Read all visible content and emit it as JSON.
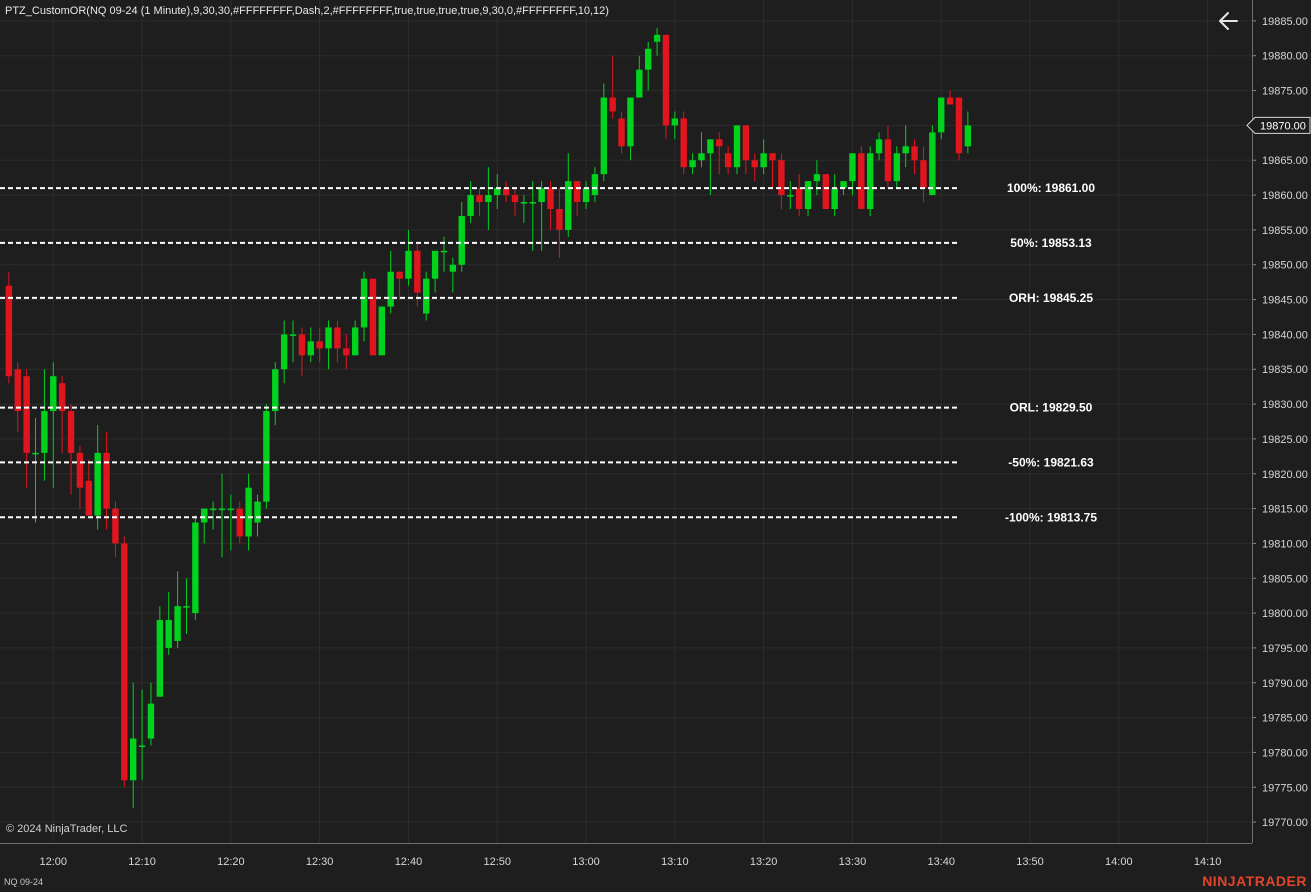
{
  "indicator_title": "PTZ_CustomOR(NQ 09-24 (1 Minute),9,30,30,#FFFFFFFF,Dash,2,#FFFFFFFF,true,true,true,true,9,30,0,#FFFFFFFF,10,12)",
  "copyright": "© 2024 NinjaTrader, LLC",
  "instrument": "NQ 09-24",
  "brand": "NINJATRADER",
  "back_icon": "arrow-left-icon",
  "colors": {
    "background": "#1e1e1e",
    "grid": "#2c2c2c",
    "up": "#00d21e",
    "down": "#e0151e",
    "level_line": "#ffffff",
    "brand": "#e0452b"
  },
  "chart_data": {
    "type": "candlestick",
    "instrument": "NQ 09-24 (1 Minute)",
    "ylim": [
      19767,
      19888
    ],
    "xlim": [
      "11:54",
      "14:15"
    ],
    "y_ticks": [
      "19885.00",
      "19880.00",
      "19875.00",
      "19870.00",
      "19865.00",
      "19860.00",
      "19855.00",
      "19850.00",
      "19845.00",
      "19840.00",
      "19835.00",
      "19830.00",
      "19825.00",
      "19820.00",
      "19815.00",
      "19810.00",
      "19805.00",
      "19800.00",
      "19795.00",
      "19790.00",
      "19785.00",
      "19780.00",
      "19775.00",
      "19770.00"
    ],
    "x_ticks": [
      "12:00",
      "12:10",
      "12:20",
      "12:30",
      "12:40",
      "12:50",
      "13:00",
      "13:10",
      "13:20",
      "13:30",
      "13:40",
      "13:50",
      "14:00",
      "14:10"
    ],
    "current_price": "19870.00",
    "levels": [
      {
        "label": "100%: 19861.00",
        "value": 19861.0
      },
      {
        "label": "50%: 19853.13",
        "value": 19853.13
      },
      {
        "label": "ORH: 19845.25",
        "value": 19845.25
      },
      {
        "label": "ORL: 19829.50",
        "value": 19829.5
      },
      {
        "label": "-50%: 19821.63",
        "value": 19821.63
      },
      {
        "label": "-100%: 19813.75",
        "value": 19813.75
      }
    ],
    "levels_end_time": "13:42",
    "candles": [
      {
        "t": "11:55",
        "o": 19847,
        "h": 19849,
        "l": 19833,
        "c": 19834
      },
      {
        "t": "11:56",
        "o": 19835,
        "h": 19836,
        "l": 19826,
        "c": 19829
      },
      {
        "t": "11:57",
        "o": 19834,
        "h": 19835,
        "l": 19818,
        "c": 19823
      },
      {
        "t": "11:58",
        "o": 19823,
        "h": 19828,
        "l": 19813,
        "c": 19823
      },
      {
        "t": "11:59",
        "o": 19823,
        "h": 19835,
        "l": 19819,
        "c": 19829
      },
      {
        "t": "12:00",
        "o": 19829,
        "h": 19836,
        "l": 19818,
        "c": 19834
      },
      {
        "t": "12:01",
        "o": 19833,
        "h": 19834,
        "l": 19823,
        "c": 19829
      },
      {
        "t": "12:02",
        "o": 19829,
        "h": 19830,
        "l": 19817,
        "c": 19823
      },
      {
        "t": "12:03",
        "o": 19823,
        "h": 19824,
        "l": 19815,
        "c": 19818
      },
      {
        "t": "12:04",
        "o": 19819,
        "h": 19822,
        "l": 19814,
        "c": 19814
      },
      {
        "t": "12:05",
        "o": 19814,
        "h": 19827,
        "l": 19812,
        "c": 19823
      },
      {
        "t": "12:06",
        "o": 19823,
        "h": 19826,
        "l": 19812,
        "c": 19815
      },
      {
        "t": "12:07",
        "o": 19815,
        "h": 19816,
        "l": 19808,
        "c": 19810
      },
      {
        "t": "12:08",
        "o": 19810,
        "h": 19811,
        "l": 19775,
        "c": 19776
      },
      {
        "t": "12:09",
        "o": 19776,
        "h": 19790,
        "l": 19772,
        "c": 19782
      },
      {
        "t": "12:10",
        "o": 19781,
        "h": 19789,
        "l": 19776,
        "c": 19781
      },
      {
        "t": "12:11",
        "o": 19782,
        "h": 19790,
        "l": 19781,
        "c": 19787
      },
      {
        "t": "12:12",
        "o": 19788,
        "h": 19801,
        "l": 19788,
        "c": 19799
      },
      {
        "t": "12:13",
        "o": 19795,
        "h": 19803,
        "l": 19794,
        "c": 19799
      },
      {
        "t": "12:14",
        "o": 19796,
        "h": 19806,
        "l": 19795,
        "c": 19801
      },
      {
        "t": "12:15",
        "o": 19801,
        "h": 19805,
        "l": 19797,
        "c": 19801
      },
      {
        "t": "12:16",
        "o": 19800,
        "h": 19814,
        "l": 19799,
        "c": 19813
      },
      {
        "t": "12:17",
        "o": 19813,
        "h": 19815,
        "l": 19810,
        "c": 19815
      },
      {
        "t": "12:18",
        "o": 19815,
        "h": 19816,
        "l": 19812,
        "c": 19815
      },
      {
        "t": "12:19",
        "o": 19815,
        "h": 19820,
        "l": 19808,
        "c": 19815
      },
      {
        "t": "12:20",
        "o": 19815,
        "h": 19817,
        "l": 19809,
        "c": 19815
      },
      {
        "t": "12:21",
        "o": 19815,
        "h": 19816,
        "l": 19810,
        "c": 19811
      },
      {
        "t": "12:22",
        "o": 19811,
        "h": 19820,
        "l": 19809,
        "c": 19818
      },
      {
        "t": "12:23",
        "o": 19813,
        "h": 19817,
        "l": 19811,
        "c": 19816
      },
      {
        "t": "12:24",
        "o": 19816,
        "h": 19830,
        "l": 19815,
        "c": 19829
      },
      {
        "t": "12:25",
        "o": 19829,
        "h": 19836,
        "l": 19827,
        "c": 19835
      },
      {
        "t": "12:26",
        "o": 19835,
        "h": 19842,
        "l": 19833,
        "c": 19840
      },
      {
        "t": "12:27",
        "o": 19840,
        "h": 19842,
        "l": 19836,
        "c": 19840
      },
      {
        "t": "12:28",
        "o": 19840,
        "h": 19841,
        "l": 19834,
        "c": 19837
      },
      {
        "t": "12:29",
        "o": 19837,
        "h": 19841,
        "l": 19836,
        "c": 19839
      },
      {
        "t": "12:30",
        "o": 19839,
        "h": 19841,
        "l": 19836,
        "c": 19838
      },
      {
        "t": "12:31",
        "o": 19838,
        "h": 19842,
        "l": 19835,
        "c": 19841
      },
      {
        "t": "12:32",
        "o": 19841,
        "h": 19842,
        "l": 19836,
        "c": 19838
      },
      {
        "t": "12:33",
        "o": 19838,
        "h": 19840,
        "l": 19835,
        "c": 19837
      },
      {
        "t": "12:34",
        "o": 19837,
        "h": 19842,
        "l": 19837,
        "c": 19841
      },
      {
        "t": "12:35",
        "o": 19841,
        "h": 19849,
        "l": 19839,
        "c": 19848
      },
      {
        "t": "12:36",
        "o": 19848,
        "h": 19848,
        "l": 19837,
        "c": 19837
      },
      {
        "t": "12:37",
        "o": 19837,
        "h": 19844,
        "l": 19837,
        "c": 19844
      },
      {
        "t": "12:38",
        "o": 19844,
        "h": 19852,
        "l": 19843,
        "c": 19849
      },
      {
        "t": "12:39",
        "o": 19849,
        "h": 19849,
        "l": 19845,
        "c": 19848
      },
      {
        "t": "12:40",
        "o": 19848,
        "h": 19855,
        "l": 19847,
        "c": 19852
      },
      {
        "t": "12:41",
        "o": 19852,
        "h": 19853,
        "l": 19844,
        "c": 19846
      },
      {
        "t": "12:42",
        "o": 19843,
        "h": 19849,
        "l": 19842,
        "c": 19848
      },
      {
        "t": "12:43",
        "o": 19848,
        "h": 19852,
        "l": 19846,
        "c": 19852
      },
      {
        "t": "12:44",
        "o": 19852,
        "h": 19854,
        "l": 19849,
        "c": 19852
      },
      {
        "t": "12:45",
        "o": 19849,
        "h": 19851,
        "l": 19846,
        "c": 19850
      },
      {
        "t": "12:46",
        "o": 19850,
        "h": 19859,
        "l": 19849,
        "c": 19857
      },
      {
        "t": "12:47",
        "o": 19857,
        "h": 19862,
        "l": 19856,
        "c": 19860
      },
      {
        "t": "12:48",
        "o": 19860,
        "h": 19861,
        "l": 19857,
        "c": 19859
      },
      {
        "t": "12:49",
        "o": 19859,
        "h": 19864,
        "l": 19855,
        "c": 19860
      },
      {
        "t": "12:50",
        "o": 19860,
        "h": 19863,
        "l": 19858,
        "c": 19861
      },
      {
        "t": "12:51",
        "o": 19861,
        "h": 19862,
        "l": 19859,
        "c": 19860
      },
      {
        "t": "12:52",
        "o": 19860,
        "h": 19861,
        "l": 19857,
        "c": 19859
      },
      {
        "t": "12:53",
        "o": 19859,
        "h": 19860,
        "l": 19856,
        "c": 19859
      },
      {
        "t": "12:54",
        "o": 19859,
        "h": 19862,
        "l": 19852,
        "c": 19859
      },
      {
        "t": "12:55",
        "o": 19859,
        "h": 19862,
        "l": 19852,
        "c": 19861
      },
      {
        "t": "12:56",
        "o": 19861,
        "h": 19862,
        "l": 19855,
        "c": 19858
      },
      {
        "t": "12:57",
        "o": 19858,
        "h": 19861,
        "l": 19851,
        "c": 19855
      },
      {
        "t": "12:58",
        "o": 19855,
        "h": 19866,
        "l": 19854,
        "c": 19862
      },
      {
        "t": "12:59",
        "o": 19862,
        "h": 19862,
        "l": 19857,
        "c": 19859
      },
      {
        "t": "13:00",
        "o": 19859,
        "h": 19862,
        "l": 19858,
        "c": 19861
      },
      {
        "t": "13:01",
        "o": 19860,
        "h": 19864,
        "l": 19859,
        "c": 19863
      },
      {
        "t": "13:02",
        "o": 19863,
        "h": 19876,
        "l": 19862,
        "c": 19874
      },
      {
        "t": "13:03",
        "o": 19874,
        "h": 19880,
        "l": 19871,
        "c": 19872
      },
      {
        "t": "13:04",
        "o": 19871,
        "h": 19872,
        "l": 19866,
        "c": 19867
      },
      {
        "t": "13:05",
        "o": 19867,
        "h": 19874,
        "l": 19865,
        "c": 19874
      },
      {
        "t": "13:06",
        "o": 19874,
        "h": 19880,
        "l": 19874,
        "c": 19878
      },
      {
        "t": "13:07",
        "o": 19878,
        "h": 19882,
        "l": 19875,
        "c": 19881
      },
      {
        "t": "13:08",
        "o": 19882,
        "h": 19884,
        "l": 19880,
        "c": 19883
      },
      {
        "t": "13:09",
        "o": 19883,
        "h": 19883,
        "l": 19868,
        "c": 19870
      },
      {
        "t": "13:10",
        "o": 19870,
        "h": 19872,
        "l": 19868,
        "c": 19871
      },
      {
        "t": "13:11",
        "o": 19871,
        "h": 19872,
        "l": 19863,
        "c": 19864
      },
      {
        "t": "13:12",
        "o": 19864,
        "h": 19866,
        "l": 19863,
        "c": 19865
      },
      {
        "t": "13:13",
        "o": 19865,
        "h": 19869,
        "l": 19864,
        "c": 19866
      },
      {
        "t": "13:14",
        "o": 19866,
        "h": 19868,
        "l": 19860,
        "c": 19868
      },
      {
        "t": "13:15",
        "o": 19868,
        "h": 19869,
        "l": 19863,
        "c": 19867
      },
      {
        "t": "13:16",
        "o": 19866,
        "h": 19867,
        "l": 19863,
        "c": 19864
      },
      {
        "t": "13:17",
        "o": 19864,
        "h": 19870,
        "l": 19863,
        "c": 19870
      },
      {
        "t": "13:18",
        "o": 19870,
        "h": 19870,
        "l": 19863,
        "c": 19865
      },
      {
        "t": "13:19",
        "o": 19865,
        "h": 19866,
        "l": 19862,
        "c": 19864
      },
      {
        "t": "13:20",
        "o": 19864,
        "h": 19868,
        "l": 19863,
        "c": 19866
      },
      {
        "t": "13:21",
        "o": 19866,
        "h": 19866,
        "l": 19861,
        "c": 19865
      },
      {
        "t": "13:22",
        "o": 19865,
        "h": 19866,
        "l": 19858,
        "c": 19860
      },
      {
        "t": "13:23",
        "o": 19860,
        "h": 19862,
        "l": 19858,
        "c": 19860
      },
      {
        "t": "13:24",
        "o": 19861,
        "h": 19863,
        "l": 19857,
        "c": 19858
      },
      {
        "t": "13:25",
        "o": 19858,
        "h": 19862,
        "l": 19857,
        "c": 19862
      },
      {
        "t": "13:26",
        "o": 19862,
        "h": 19865,
        "l": 19860,
        "c": 19863
      },
      {
        "t": "13:27",
        "o": 19863,
        "h": 19863,
        "l": 19858,
        "c": 19858
      },
      {
        "t": "13:28",
        "o": 19858,
        "h": 19863,
        "l": 19857,
        "c": 19861
      },
      {
        "t": "13:29",
        "o": 19861,
        "h": 19862,
        "l": 19860,
        "c": 19862
      },
      {
        "t": "13:30",
        "o": 19862,
        "h": 19866,
        "l": 19860,
        "c": 19866
      },
      {
        "t": "13:31",
        "o": 19866,
        "h": 19867,
        "l": 19858,
        "c": 19858
      },
      {
        "t": "13:32",
        "o": 19858,
        "h": 19867,
        "l": 19857,
        "c": 19866
      },
      {
        "t": "13:33",
        "o": 19866,
        "h": 19869,
        "l": 19865,
        "c": 19868
      },
      {
        "t": "13:34",
        "o": 19868,
        "h": 19870,
        "l": 19861,
        "c": 19862
      },
      {
        "t": "13:35",
        "o": 19862,
        "h": 19867,
        "l": 19861,
        "c": 19866
      },
      {
        "t": "13:36",
        "o": 19866,
        "h": 19870,
        "l": 19864,
        "c": 19867
      },
      {
        "t": "13:37",
        "o": 19867,
        "h": 19868,
        "l": 19863,
        "c": 19865
      },
      {
        "t": "13:38",
        "o": 19865,
        "h": 19867,
        "l": 19859,
        "c": 19861
      },
      {
        "t": "13:39",
        "o": 19860,
        "h": 19870,
        "l": 19860,
        "c": 19869
      },
      {
        "t": "13:40",
        "o": 19869,
        "h": 19874,
        "l": 19868,
        "c": 19874
      },
      {
        "t": "13:41",
        "o": 19874,
        "h": 19875,
        "l": 19873,
        "c": 19873
      },
      {
        "t": "13:42",
        "o": 19874,
        "h": 19874,
        "l": 19865,
        "c": 19866
      },
      {
        "t": "13:43",
        "o": 19867,
        "h": 19872,
        "l": 19866,
        "c": 19870
      }
    ]
  }
}
